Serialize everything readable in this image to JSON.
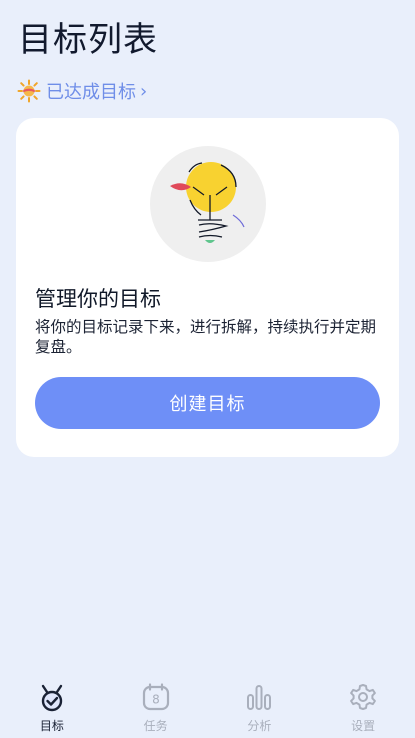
{
  "header": {
    "title": "目标列表"
  },
  "achieved": {
    "label": "已达成目标",
    "chevron": "›",
    "icon": "sun-badge-icon"
  },
  "empty_card": {
    "illustration": "lightbulb-illustration",
    "title": "管理你的目标",
    "description": "将你的目标记录下来，进行拆解，持续执行并定期复盘。",
    "button_label": "创建目标"
  },
  "tabbar": {
    "active": "goals",
    "items": [
      {
        "key": "goals",
        "label": "目标",
        "icon": "medal-icon"
      },
      {
        "key": "tasks",
        "label": "任务",
        "icon": "calendar-icon",
        "badge": "8"
      },
      {
        "key": "analysis",
        "label": "分析",
        "icon": "bar-chart-icon"
      },
      {
        "key": "settings",
        "label": "设置",
        "icon": "gear-icon"
      }
    ]
  },
  "colors": {
    "background": "#e9effb",
    "accent": "#6e8ff7",
    "link": "#6f8ee8",
    "sun": "#f0a529",
    "bulb": "#f8d230"
  }
}
